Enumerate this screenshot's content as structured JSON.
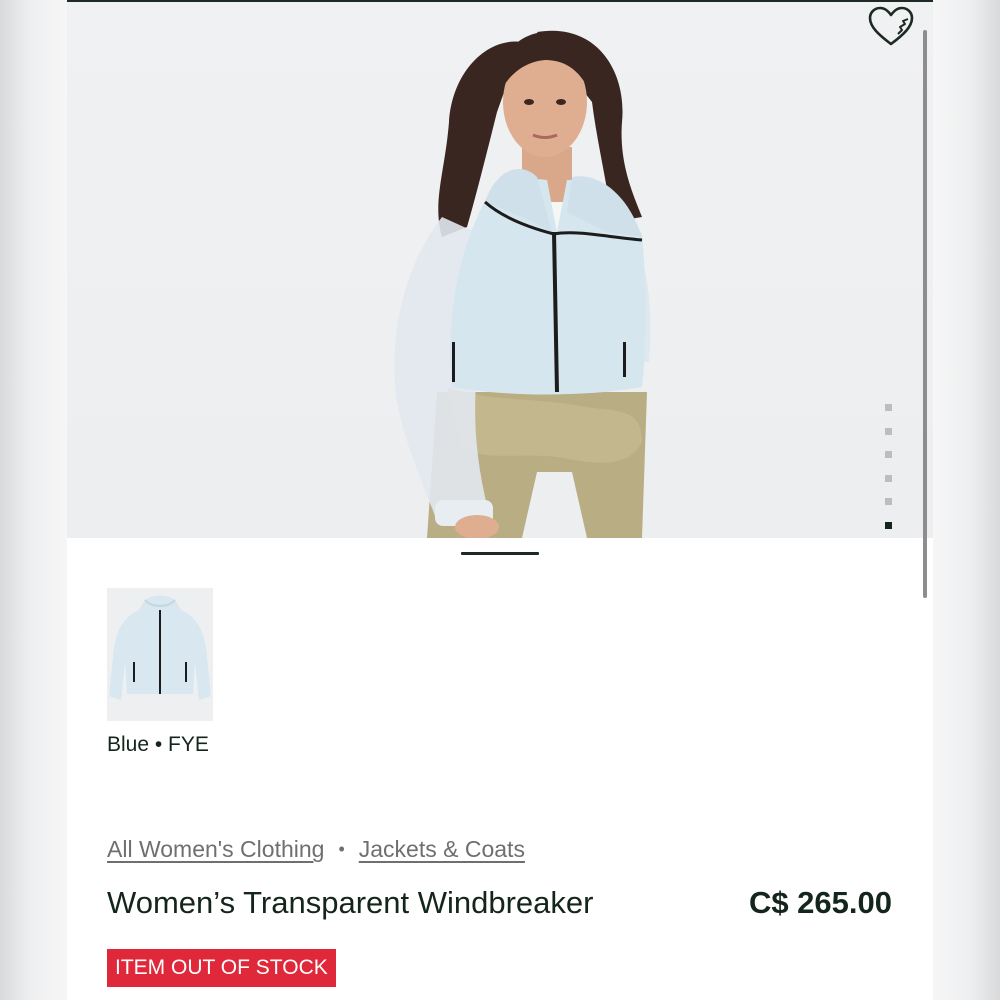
{
  "product": {
    "name": "Women’s Transparent Windbreaker",
    "price": "C$ 265.00",
    "color_label": "Blue • FYE",
    "stock_badge": "ITEM OUT OF STOCK",
    "stock_badge_color": "#e0283b"
  },
  "breadcrumb": {
    "items": [
      {
        "label": "All Women's Clothing"
      },
      {
        "label": "Jackets & Coats"
      }
    ],
    "separator": "•"
  },
  "gallery": {
    "image_count": 6,
    "active_index": 5,
    "wishlist_icon": "heart-icon",
    "thumbnail_icon": "jacket-thumbnail"
  },
  "colors": {
    "text_primary": "#14251c",
    "text_muted": "#6f6f6f",
    "jacket": "#dbe7ef",
    "pants": "#b9ad84"
  }
}
